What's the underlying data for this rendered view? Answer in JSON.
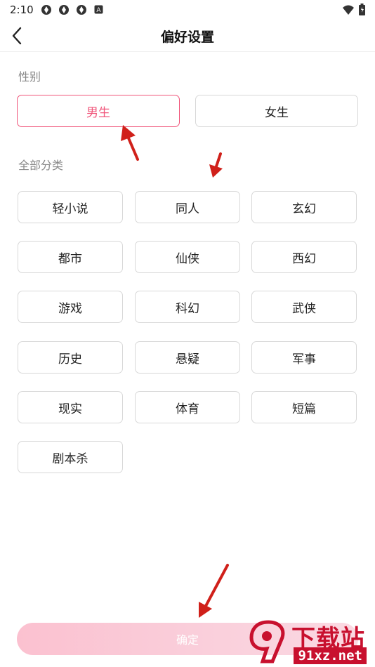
{
  "status_bar": {
    "time": "2:10",
    "left_icons": [
      "app-notification-icon",
      "app-notification-icon",
      "app-notification-icon",
      "a-badge-icon"
    ],
    "right_icons": [
      "wifi-icon",
      "battery-icon"
    ]
  },
  "header": {
    "title": "偏好设置",
    "back_icon": "chevron-left-icon"
  },
  "gender": {
    "label": "性别",
    "options": [
      {
        "label": "男生",
        "selected": true
      },
      {
        "label": "女生",
        "selected": false
      }
    ]
  },
  "categories": {
    "label": "全部分类",
    "items": [
      "轻小说",
      "同人",
      "玄幻",
      "都市",
      "仙侠",
      "西幻",
      "游戏",
      "科幻",
      "武侠",
      "历史",
      "悬疑",
      "军事",
      "现实",
      "体育",
      "短篇",
      "剧本杀"
    ]
  },
  "confirm": {
    "label": "确定"
  },
  "watermark": {
    "title": "下载站",
    "domain": "91xz.net"
  },
  "colors": {
    "accent": "#f0557a",
    "confirm_bg": "#fbc8d5",
    "annotation_arrow": "#d0201a"
  }
}
